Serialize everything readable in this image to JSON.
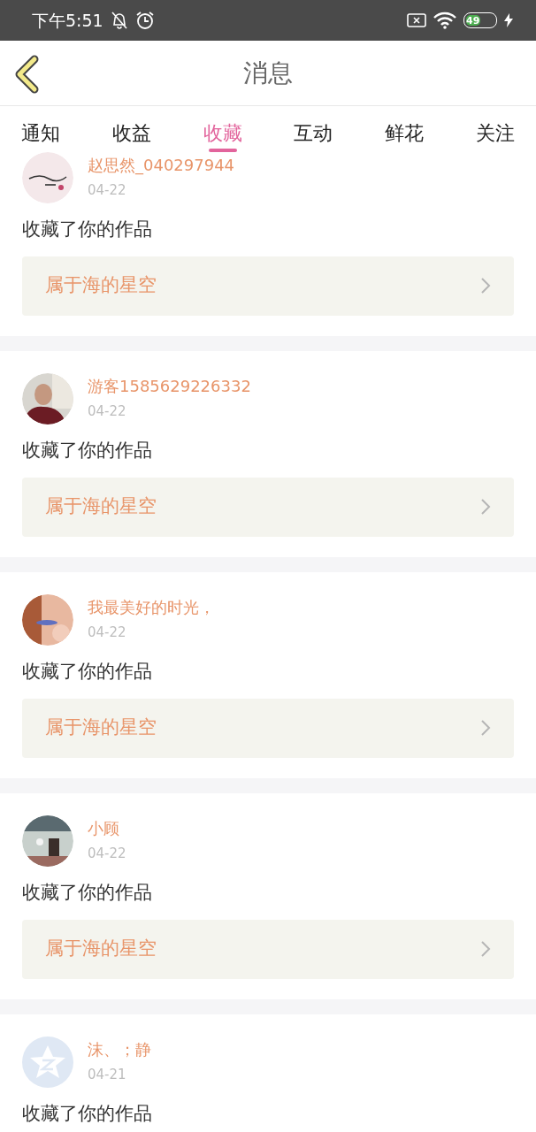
{
  "status_bar": {
    "time": "下午5:51",
    "battery": "49"
  },
  "header": {
    "title": "消息"
  },
  "tabs": [
    {
      "label": "通知",
      "selected": false
    },
    {
      "label": "收益",
      "selected": false
    },
    {
      "label": "收藏",
      "selected": true
    },
    {
      "label": "互动",
      "selected": false
    },
    {
      "label": "鲜花",
      "selected": false
    },
    {
      "label": "关注",
      "selected": false
    }
  ],
  "messages": [
    {
      "name": "赵思然_040297944",
      "date": "04-22",
      "action": "收藏了你的作品",
      "work": "属于海的星空"
    },
    {
      "name": "游客1585629226332",
      "date": "04-22",
      "action": "收藏了你的作品",
      "work": "属于海的星空"
    },
    {
      "name": "我最美好的时光，",
      "date": "04-22",
      "action": "收藏了你的作品",
      "work": "属于海的星空"
    },
    {
      "name": "小顾",
      "date": "04-22",
      "action": "收藏了你的作品",
      "work": "属于海的星空"
    },
    {
      "kind": "default",
      "name": "沫、；静",
      "date": "04-21",
      "action": "收藏了你的作品"
    }
  ]
}
